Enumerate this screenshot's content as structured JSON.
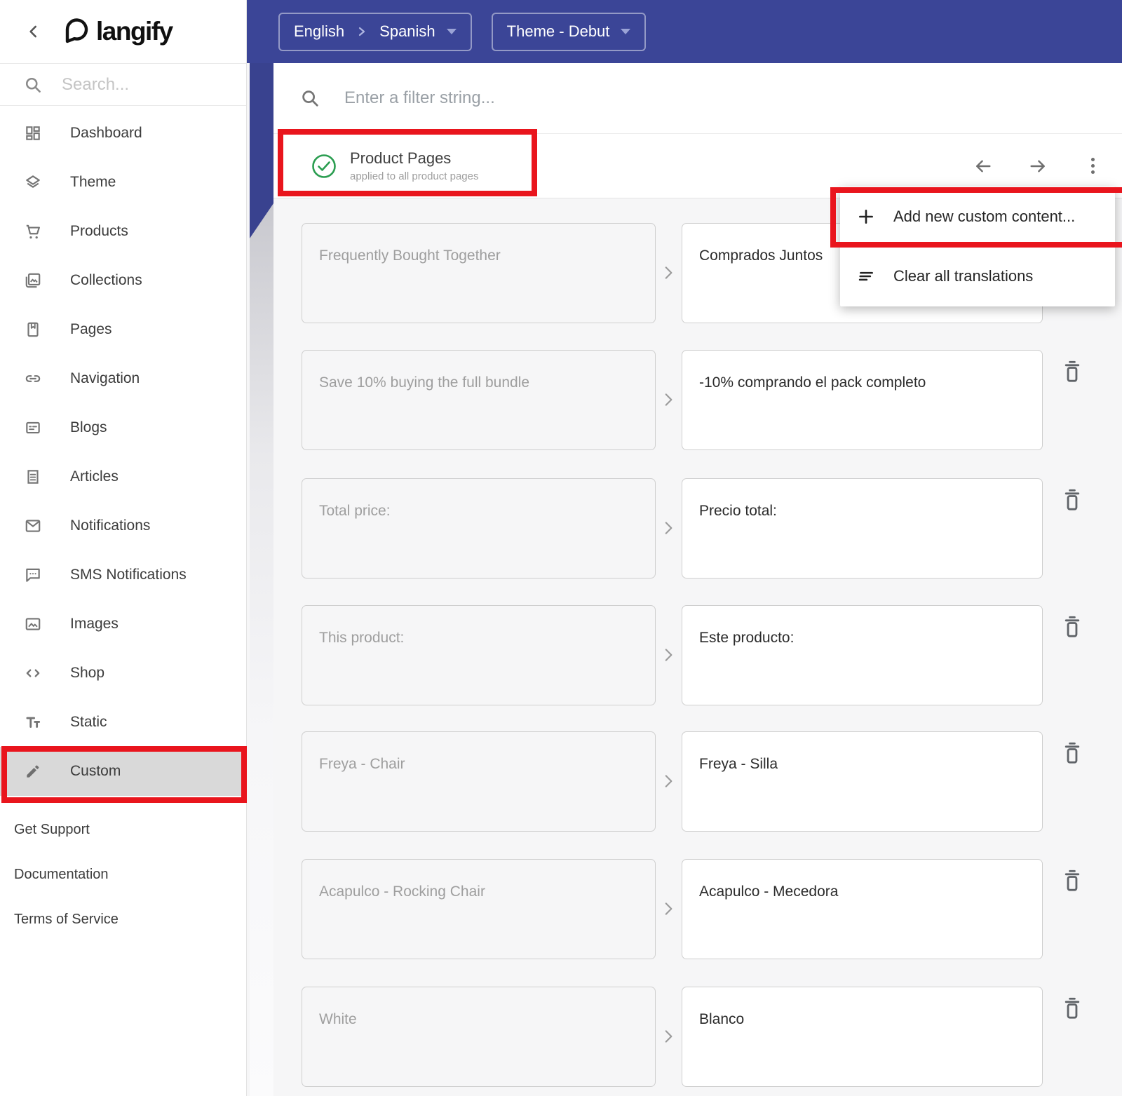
{
  "app": {
    "logo_text": "langify"
  },
  "topbar": {
    "language_pair": {
      "source": "English",
      "target": "Spanish"
    },
    "theme_selector_label": "Theme - Debut"
  },
  "sidebar": {
    "search_placeholder": "Search...",
    "items": [
      {
        "label": "Dashboard"
      },
      {
        "label": "Theme"
      },
      {
        "label": "Products"
      },
      {
        "label": "Collections"
      },
      {
        "label": "Pages"
      },
      {
        "label": "Navigation"
      },
      {
        "label": "Blogs"
      },
      {
        "label": "Articles"
      },
      {
        "label": "Notifications"
      },
      {
        "label": "SMS Notifications"
      },
      {
        "label": "Images"
      },
      {
        "label": "Shop"
      },
      {
        "label": "Static"
      },
      {
        "label": "Custom"
      }
    ],
    "active_item": "Custom",
    "footer_links": [
      {
        "label": "Get Support"
      },
      {
        "label": "Documentation"
      },
      {
        "label": "Terms of Service"
      }
    ]
  },
  "content": {
    "filter_placeholder": "Enter a filter string...",
    "section": {
      "title": "Product Pages",
      "subtitle": "applied to all product pages"
    },
    "rows": [
      {
        "source": "Frequently Bought Together",
        "translation": "Comprados Juntos"
      },
      {
        "source": "Save 10% buying the full bundle",
        "translation": "-10% comprando el pack completo"
      },
      {
        "source": "Total price:",
        "translation": "Precio total:"
      },
      {
        "source": "This product:",
        "translation": "Este producto:"
      },
      {
        "source": "Freya - Chair",
        "translation": "Freya - Silla"
      },
      {
        "source": "Acapulco - Rocking Chair",
        "translation": "Acapulco - Mecedora"
      },
      {
        "source": "White",
        "translation": "Blanco"
      }
    ]
  },
  "context_menu": {
    "items": [
      {
        "label": "Add new custom content..."
      },
      {
        "label": "Clear all translations"
      }
    ]
  },
  "colors": {
    "primary_indigo": "#3b4597",
    "annotation_red": "#e9151d",
    "success_green": "#2a9d50",
    "active_item_gray": "#d9d9d9"
  }
}
